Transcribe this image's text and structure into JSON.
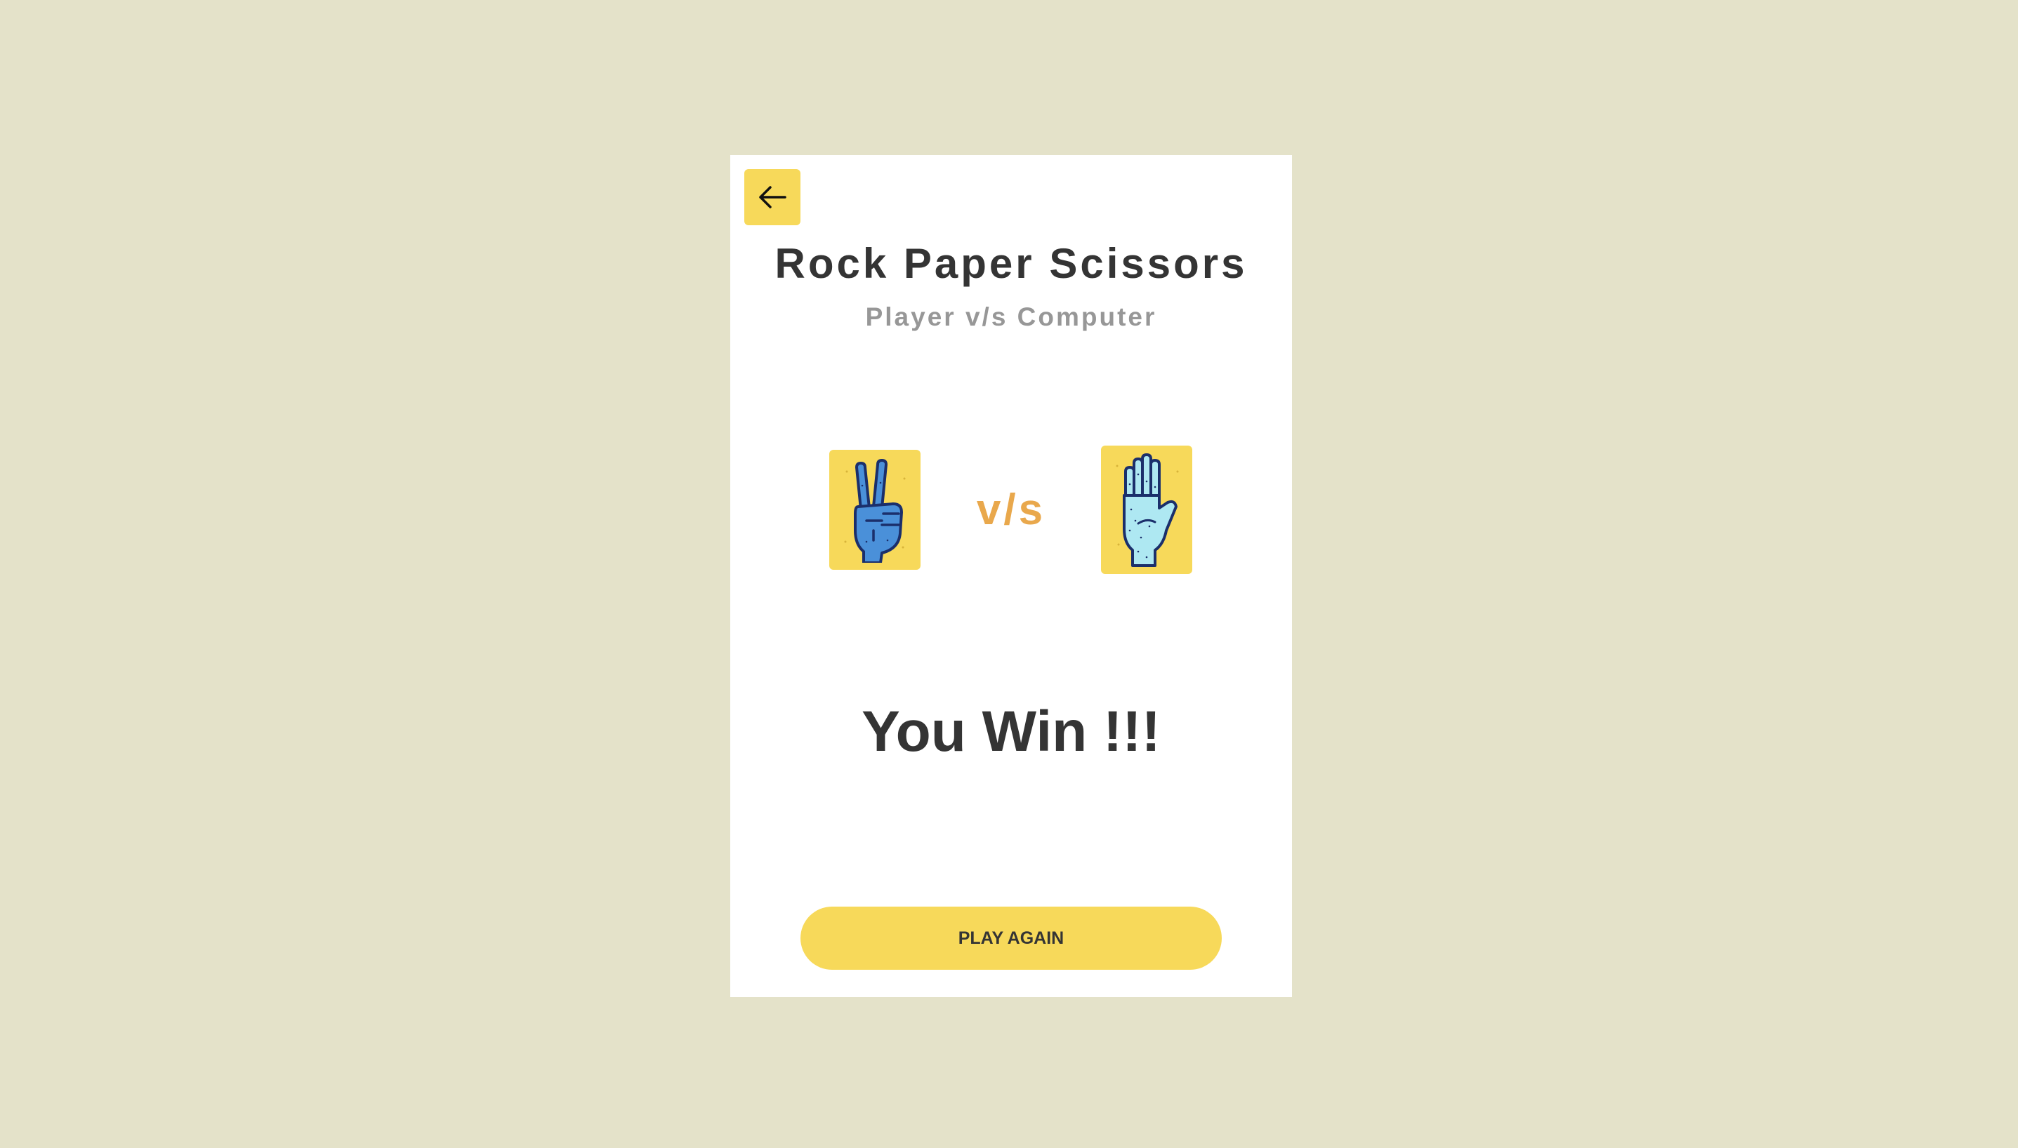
{
  "game": {
    "title": "Rock Paper Scissors",
    "subtitle": "Player v/s Computer",
    "vs_label": "v/s",
    "result_text": "You Win !!!",
    "play_again_label": "PLAY AGAIN"
  },
  "player": {
    "choice": "scissors",
    "icon": "scissors-hand-icon"
  },
  "computer": {
    "choice": "paper",
    "icon": "paper-hand-icon"
  },
  "icons": {
    "back": "arrow-left-icon"
  },
  "colors": {
    "background": "#e4e2c9",
    "card": "#ffffff",
    "accent_yellow": "#f7d95a",
    "vs_orange": "#e9a84c",
    "title_text": "#343434",
    "subtitle_text": "#979797",
    "scissors_hand": "#4a90d9",
    "paper_hand": "#aee8f2",
    "hand_outline": "#1b2f6b"
  }
}
